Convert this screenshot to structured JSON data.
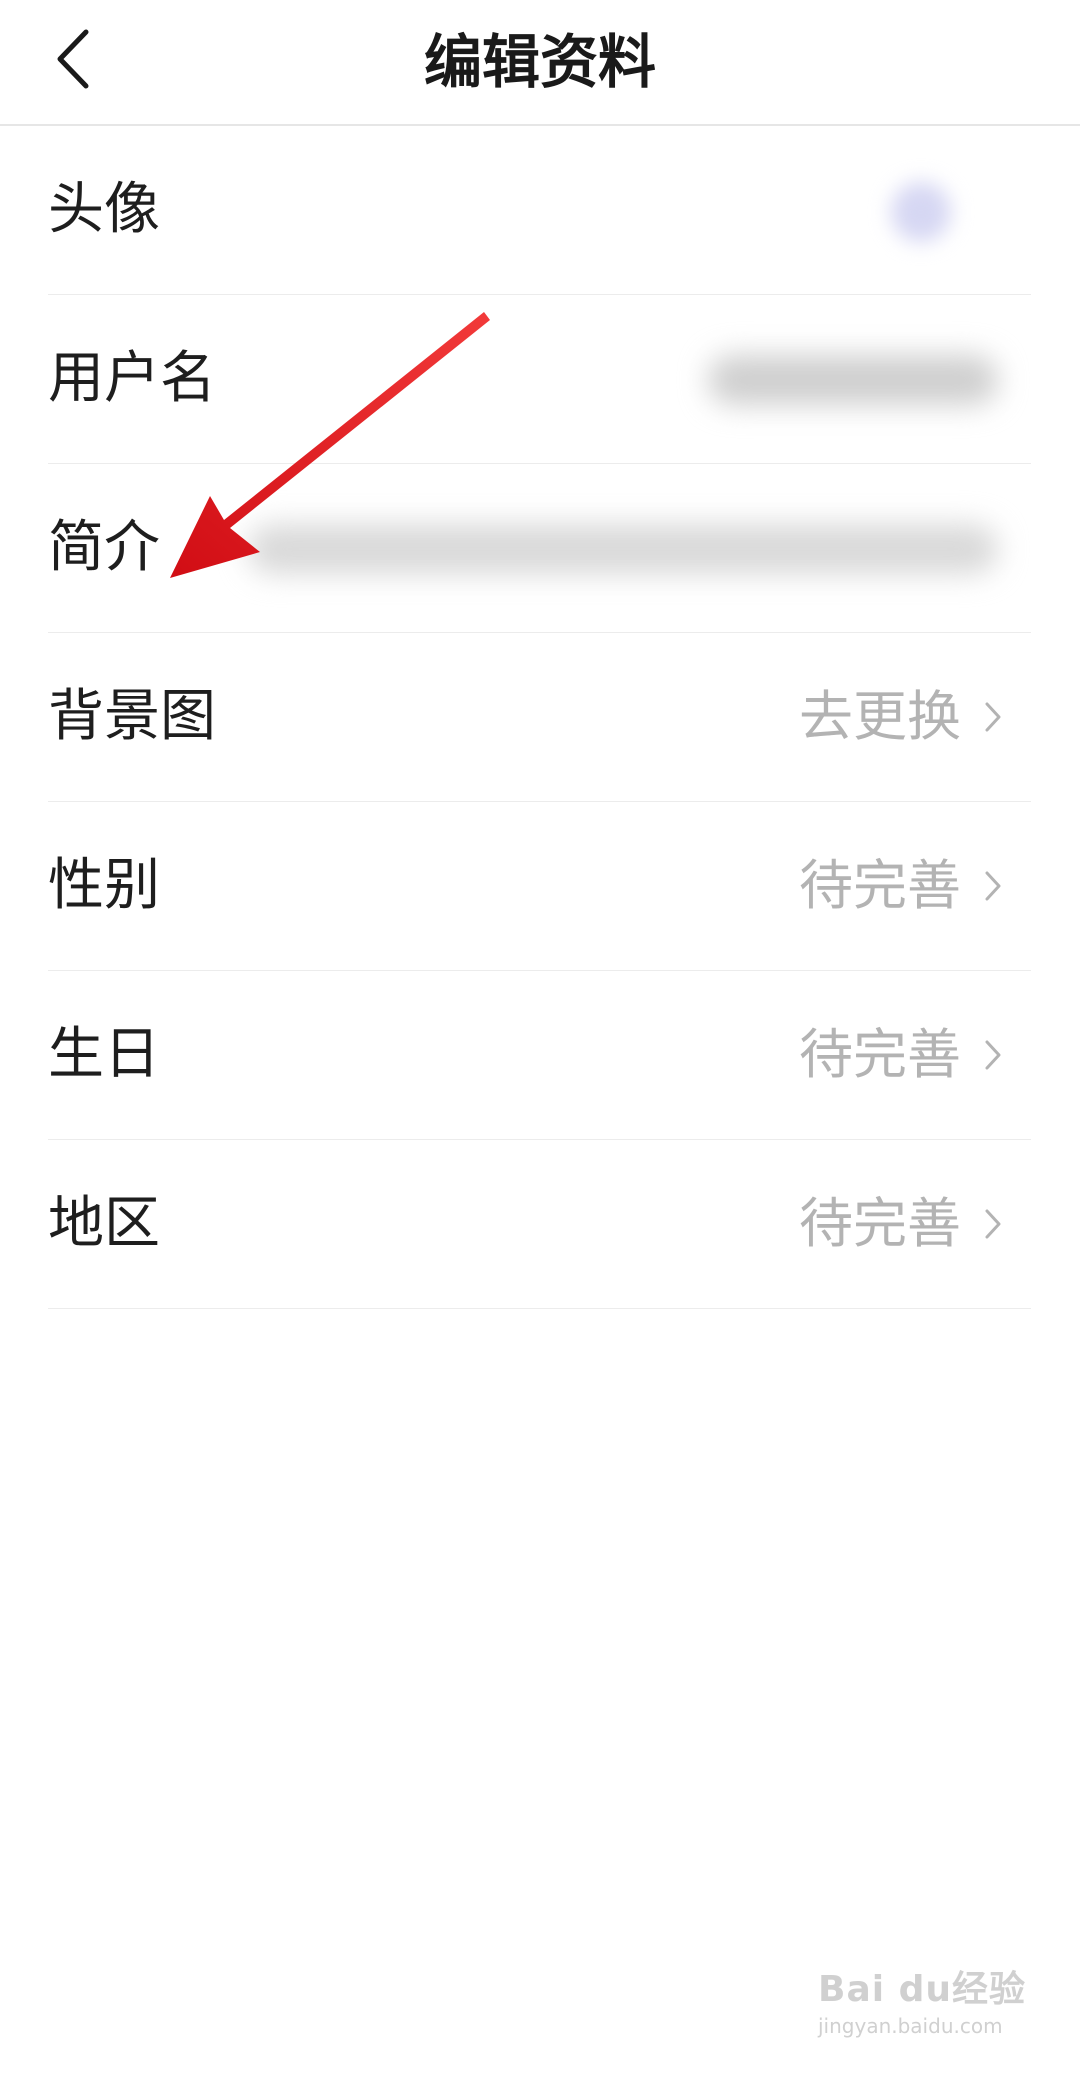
{
  "header": {
    "title": "编辑资料",
    "back_icon": "chevron-left-icon"
  },
  "rows": [
    {
      "label": "头像",
      "value": ""
    },
    {
      "label": "用户名",
      "value": ""
    },
    {
      "label": "简介",
      "value": ""
    },
    {
      "label": "背景图",
      "value": "去更换"
    },
    {
      "label": "性别",
      "value": "待完善"
    },
    {
      "label": "生日",
      "value": "待完善"
    },
    {
      "label": "地区",
      "value": "待完善"
    }
  ],
  "colors": {
    "arrow": "#e3131b",
    "value_text": "#b3b3b3",
    "divider": "#ececec"
  },
  "watermark": {
    "main": "Bai du经验",
    "sub": "jingyan.baidu.com"
  }
}
